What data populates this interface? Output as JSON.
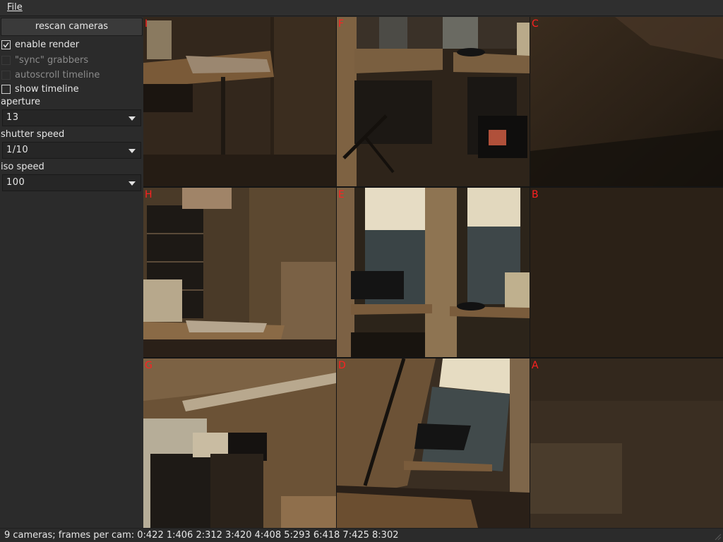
{
  "menubar": {
    "file_label": "File"
  },
  "sidebar": {
    "rescan_label": "rescan cameras",
    "checkboxes": [
      {
        "label": "enable render",
        "checked": true,
        "enabled": true
      },
      {
        "label": "\"sync\" grabbers",
        "checked": false,
        "enabled": false
      },
      {
        "label": "autoscroll timeline",
        "checked": false,
        "enabled": false
      },
      {
        "label": "show timeline",
        "checked": false,
        "enabled": true
      }
    ],
    "aperture": {
      "label": "aperture",
      "value": "13"
    },
    "shutter_speed": {
      "label": "shutter speed",
      "value": "1/10"
    },
    "iso_speed": {
      "label": "iso speed",
      "value": "100"
    }
  },
  "cameras": [
    {
      "label": "I",
      "scene": "desk-corner"
    },
    {
      "label": "F",
      "scene": "desks-chairs"
    },
    {
      "label": "C",
      "scene": "blurred-closeup"
    },
    {
      "label": "H",
      "scene": "shelves-wall"
    },
    {
      "label": "E",
      "scene": "window-desks"
    },
    {
      "label": "B",
      "scene": "dark-blank"
    },
    {
      "label": "G",
      "scene": "ceiling-shelves"
    },
    {
      "label": "D",
      "scene": "window-angle"
    },
    {
      "label": "A",
      "scene": "blurred-blank"
    }
  ],
  "status": {
    "text": "9 cameras; frames per cam: 0:422 1:406 2:312 3:420 4:408 5:293 6:418 7:425 8:302"
  },
  "colors": {
    "camera_label": "#ff2020",
    "background": "#2b2b2b"
  }
}
